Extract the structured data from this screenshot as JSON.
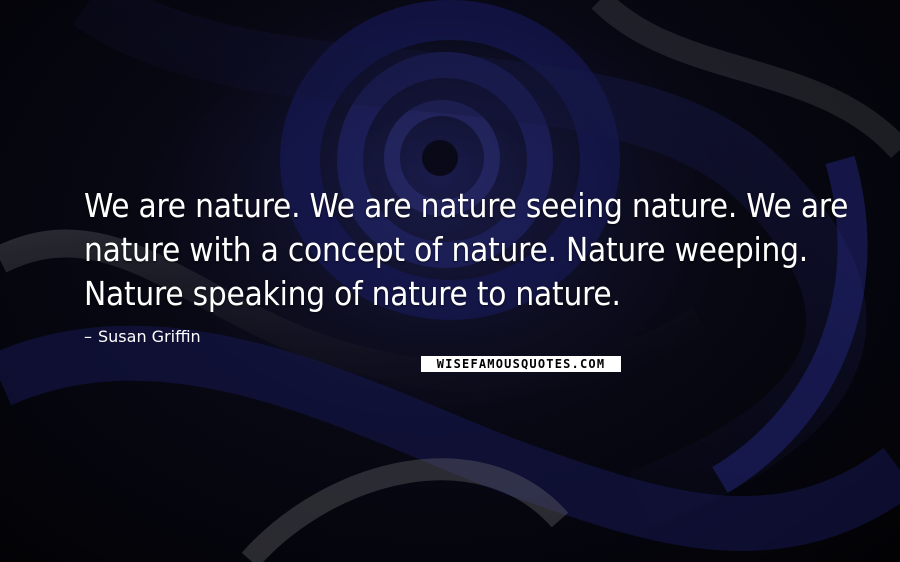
{
  "quote": {
    "text": "We are nature. We are nature seeing nature. We are nature with a concept of nature. Nature weeping. Nature speaking of nature to nature."
  },
  "author": {
    "dash": "–",
    "name": "Susan Griffin"
  },
  "watermark": {
    "text": "WISEFAMOUSQUOTES.COM"
  },
  "colors": {
    "text": "#ffffff",
    "background_dark": "#05050a",
    "swirl_blue": "#1c1f6b",
    "swirl_gray": "#6a6a72"
  }
}
